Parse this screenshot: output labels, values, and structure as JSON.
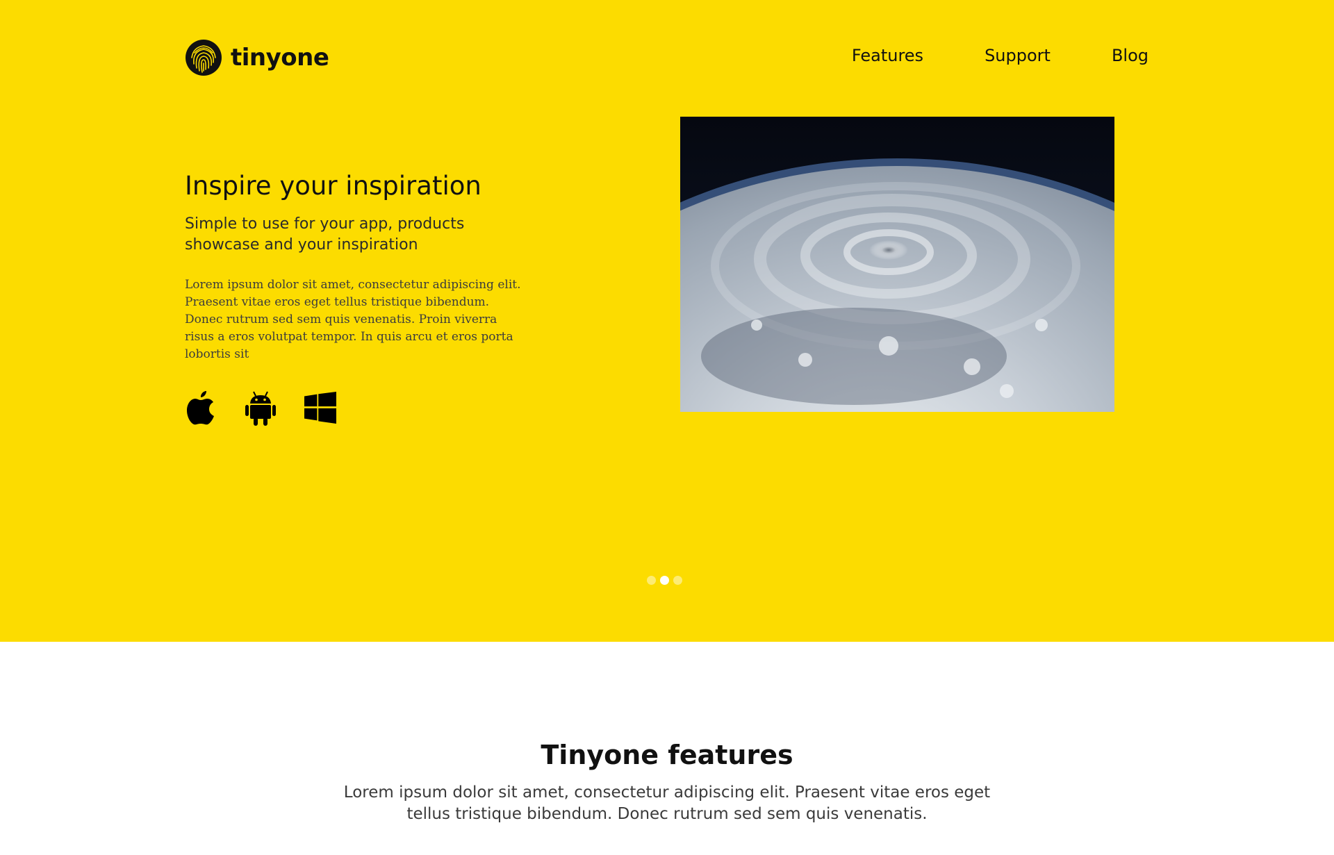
{
  "brand": {
    "name": "tinyone",
    "logo_icon": "fingerprint-icon"
  },
  "nav": {
    "items": [
      {
        "label": "Features"
      },
      {
        "label": "Support"
      },
      {
        "label": "Blog"
      }
    ]
  },
  "hero": {
    "title": "Inspire your inspiration",
    "subtitle": "Simple to use for your app, products showcase and your inspiration",
    "body": "Lorem ipsum dolor sit amet, consectetur adipiscing elit. Praesent vitae eros eget tellus tristique bibendum. Donec rutrum sed sem quis venenatis. Proin viverra risus a eros volutpat tempor. In quis arcu et eros porta lobortis sit",
    "platforms": [
      {
        "icon": "apple-icon"
      },
      {
        "icon": "android-icon"
      },
      {
        "icon": "windows-icon"
      }
    ],
    "image": "hurricane-from-space",
    "carousel": {
      "count": 3,
      "active_index": 1
    },
    "background_color": "#fcdc00"
  },
  "features": {
    "title": "Tinyone features",
    "description": "Lorem ipsum dolor sit amet, consectetur adipiscing elit. Praesent vitae eros eget tellus tristique bibendum. Donec rutrum sed sem quis venenatis."
  }
}
